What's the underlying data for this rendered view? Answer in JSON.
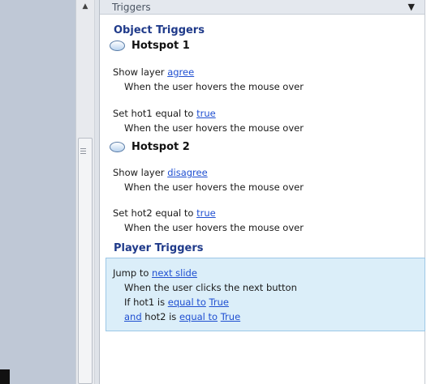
{
  "panel": {
    "title": "Triggers",
    "menu_icon": "triangle-down"
  },
  "sections": {
    "object_triggers": "Object Triggers",
    "player_triggers": "Player Triggers"
  },
  "hotspot1": {
    "name": "Hotspot 1",
    "t1": {
      "action": "Show layer",
      "target": "agree",
      "when": "When the user hovers the mouse over"
    },
    "t2": {
      "action": "Set hot1 equal to",
      "target": "true",
      "when": "When the user hovers the mouse over"
    }
  },
  "hotspot2": {
    "name": "Hotspot 2",
    "t1": {
      "action": "Show layer",
      "target": "disagree",
      "when": "When the user hovers the mouse over"
    },
    "t2": {
      "action": "Set hot2 equal to",
      "target": "true",
      "when": "When the user hovers the mouse over"
    }
  },
  "player": {
    "action": "Jump to",
    "target": "next slide",
    "when": "When the user clicks the next button",
    "cond1_prefix": "If hot1 is",
    "cond1_op": "equal to",
    "cond1_val": "True",
    "and": "and",
    "cond2_prefix": "hot2 is",
    "cond2_op": "equal to",
    "cond2_val": "True"
  }
}
